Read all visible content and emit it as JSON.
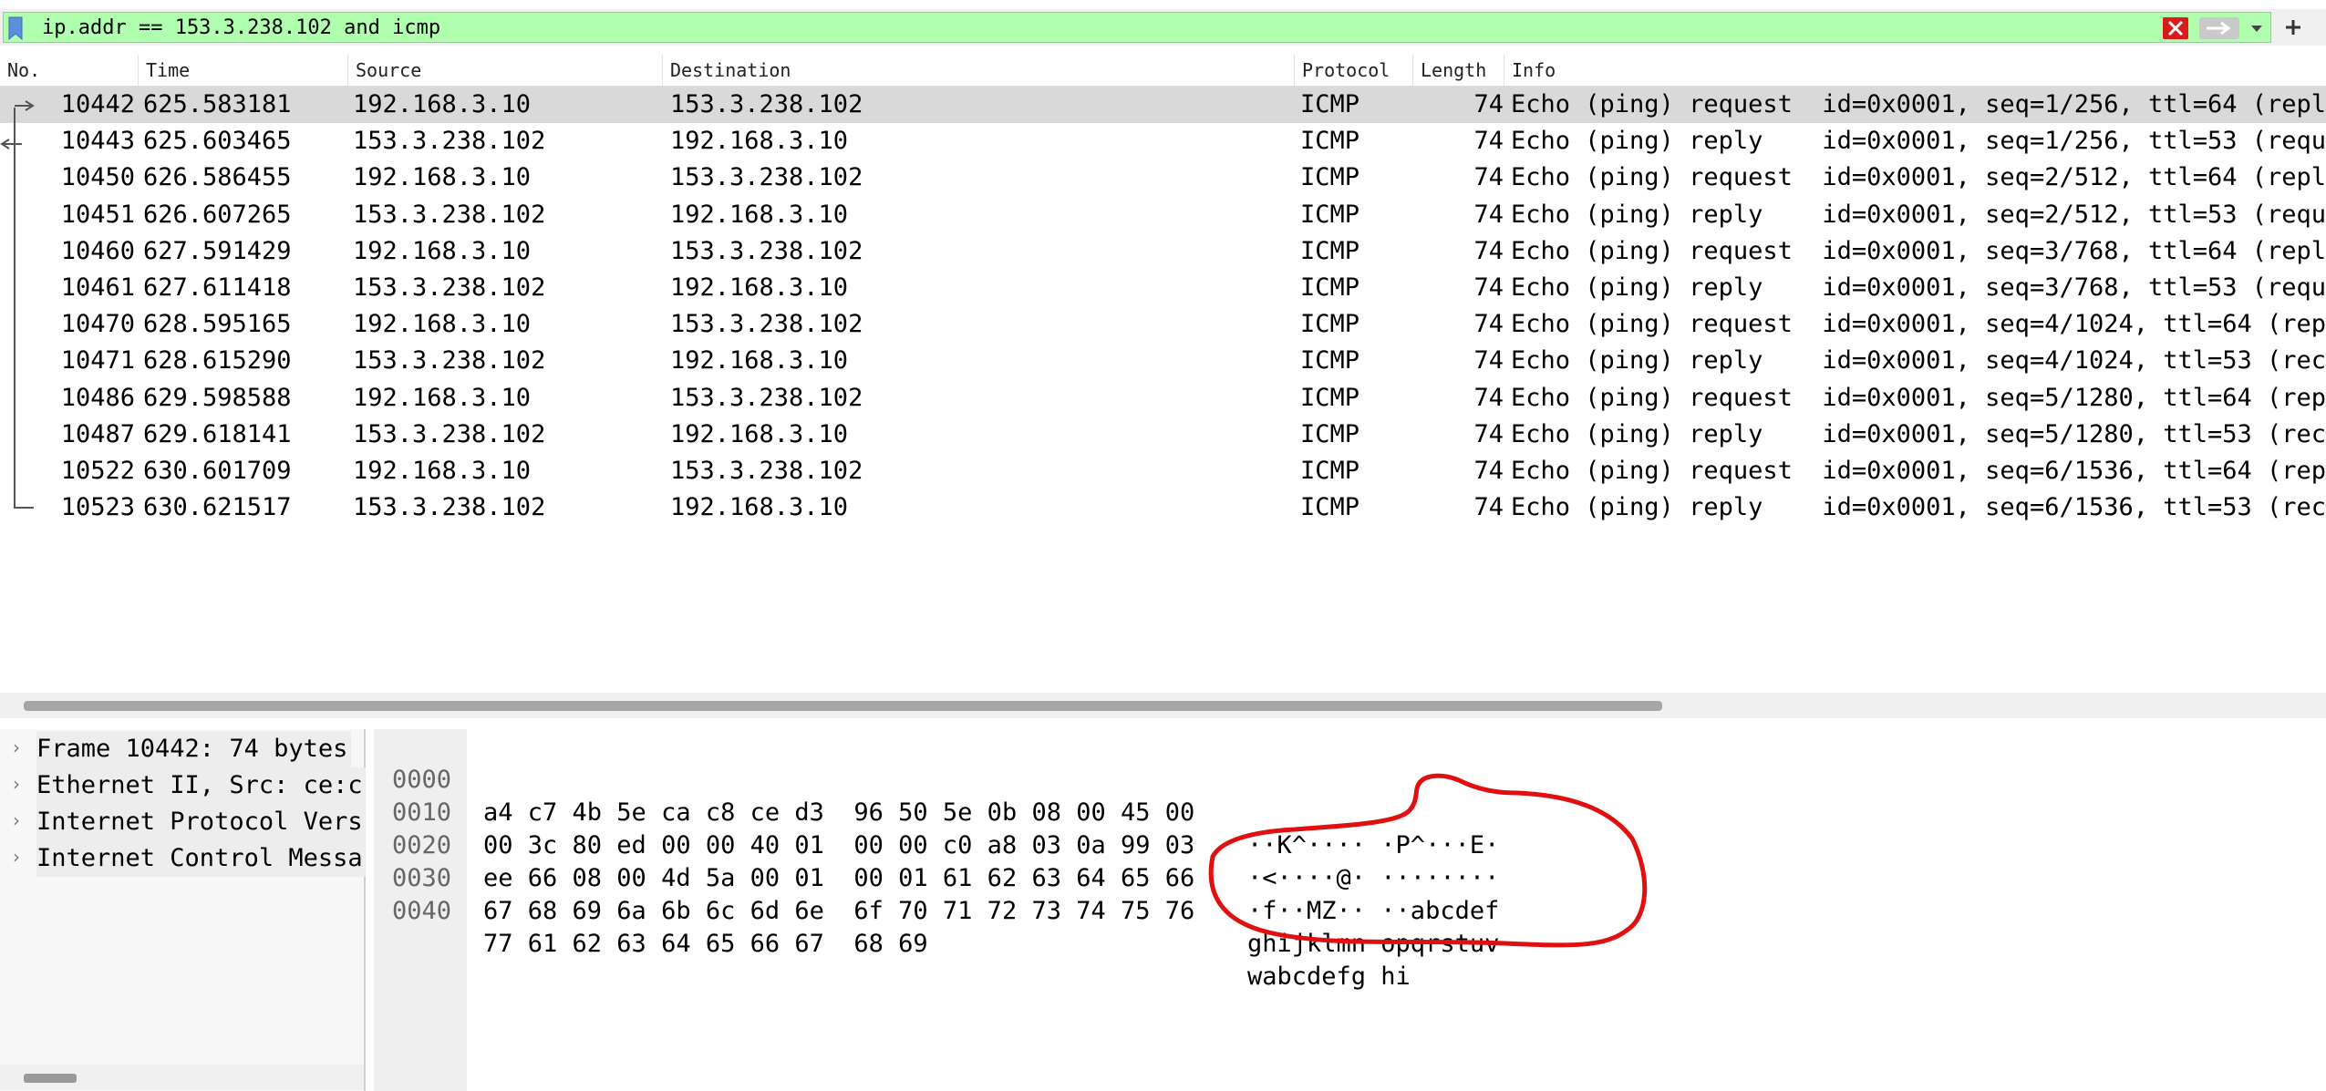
{
  "filter": {
    "text": "ip.addr == 153.3.238.102 and icmp",
    "bookmark_icon": "bookmark-icon",
    "clear_icon": "clear-filter-icon",
    "apply_icon": "apply-arrow-icon",
    "dropdown_icon": "chevron-down-icon",
    "add_icon": "plus-icon",
    "colors": {
      "valid_bg": "#afffaf",
      "clear": "#dd1111"
    }
  },
  "packet_list": {
    "columns": [
      "No.",
      "Time",
      "Source",
      "Destination",
      "Protocol",
      "Length",
      "Info"
    ],
    "rows": [
      {
        "no": "10442",
        "time": "625.583181",
        "src": "192.168.3.10",
        "dst": "153.3.238.102",
        "proto": "ICMP",
        "len": "74",
        "info": "Echo (ping) request  id=0x0001, seq=1/256, ttl=64 (repl"
      },
      {
        "no": "10443",
        "time": "625.603465",
        "src": "153.3.238.102",
        "dst": "192.168.3.10",
        "proto": "ICMP",
        "len": "74",
        "info": "Echo (ping) reply    id=0x0001, seq=1/256, ttl=53 (requ"
      },
      {
        "no": "10450",
        "time": "626.586455",
        "src": "192.168.3.10",
        "dst": "153.3.238.102",
        "proto": "ICMP",
        "len": "74",
        "info": "Echo (ping) request  id=0x0001, seq=2/512, ttl=64 (repl"
      },
      {
        "no": "10451",
        "time": "626.607265",
        "src": "153.3.238.102",
        "dst": "192.168.3.10",
        "proto": "ICMP",
        "len": "74",
        "info": "Echo (ping) reply    id=0x0001, seq=2/512, ttl=53 (requ"
      },
      {
        "no": "10460",
        "time": "627.591429",
        "src": "192.168.3.10",
        "dst": "153.3.238.102",
        "proto": "ICMP",
        "len": "74",
        "info": "Echo (ping) request  id=0x0001, seq=3/768, ttl=64 (repl"
      },
      {
        "no": "10461",
        "time": "627.611418",
        "src": "153.3.238.102",
        "dst": "192.168.3.10",
        "proto": "ICMP",
        "len": "74",
        "info": "Echo (ping) reply    id=0x0001, seq=3/768, ttl=53 (requ"
      },
      {
        "no": "10470",
        "time": "628.595165",
        "src": "192.168.3.10",
        "dst": "153.3.238.102",
        "proto": "ICMP",
        "len": "74",
        "info": "Echo (ping) request  id=0x0001, seq=4/1024, ttl=64 (rep"
      },
      {
        "no": "10471",
        "time": "628.615290",
        "src": "153.3.238.102",
        "dst": "192.168.3.10",
        "proto": "ICMP",
        "len": "74",
        "info": "Echo (ping) reply    id=0x0001, seq=4/1024, ttl=53 (rec"
      },
      {
        "no": "10486",
        "time": "629.598588",
        "src": "192.168.3.10",
        "dst": "153.3.238.102",
        "proto": "ICMP",
        "len": "74",
        "info": "Echo (ping) request  id=0x0001, seq=5/1280, ttl=64 (rep"
      },
      {
        "no": "10487",
        "time": "629.618141",
        "src": "153.3.238.102",
        "dst": "192.168.3.10",
        "proto": "ICMP",
        "len": "74",
        "info": "Echo (ping) reply    id=0x0001, seq=5/1280, ttl=53 (rec"
      },
      {
        "no": "10522",
        "time": "630.601709",
        "src": "192.168.3.10",
        "dst": "153.3.238.102",
        "proto": "ICMP",
        "len": "74",
        "info": "Echo (ping) request  id=0x0001, seq=6/1536, ttl=64 (rep"
      },
      {
        "no": "10523",
        "time": "630.621517",
        "src": "153.3.238.102",
        "dst": "192.168.3.10",
        "proto": "ICMP",
        "len": "74",
        "info": "Echo (ping) reply    id=0x0001, seq=6/1536, ttl=53 (rec"
      }
    ]
  },
  "details": {
    "items": [
      "Frame 10442: 74 bytes",
      "Ethernet II, Src: ce:c",
      "Internet Protocol Vers",
      "Internet Control Messa"
    ]
  },
  "bytes": {
    "rows": [
      {
        "offset": "0000",
        "hex": "a4 c7 4b 5e ca c8 ce d3  96 50 5e 0b 08 00 45 00",
        "ascii": "··K^···· ·P^···E·"
      },
      {
        "offset": "0010",
        "hex": "00 3c 80 ed 00 00 40 01  00 00 c0 a8 03 0a 99 03",
        "ascii": "·<····@· ········"
      },
      {
        "offset": "0020",
        "hex": "ee 66 08 00 4d 5a 00 01  00 01 61 62 63 64 65 66",
        "ascii": "·f··MZ·· ··abcdef"
      },
      {
        "offset": "0030",
        "hex": "67 68 69 6a 6b 6c 6d 6e  6f 70 71 72 73 74 75 76",
        "ascii": "ghijklmn opqrstuv"
      },
      {
        "offset": "0040",
        "hex": "77 61 62 63 64 65 66 67  68 69",
        "ascii": "wabcdefg hi"
      }
    ]
  },
  "annotation": {
    "color": "#e01010"
  }
}
